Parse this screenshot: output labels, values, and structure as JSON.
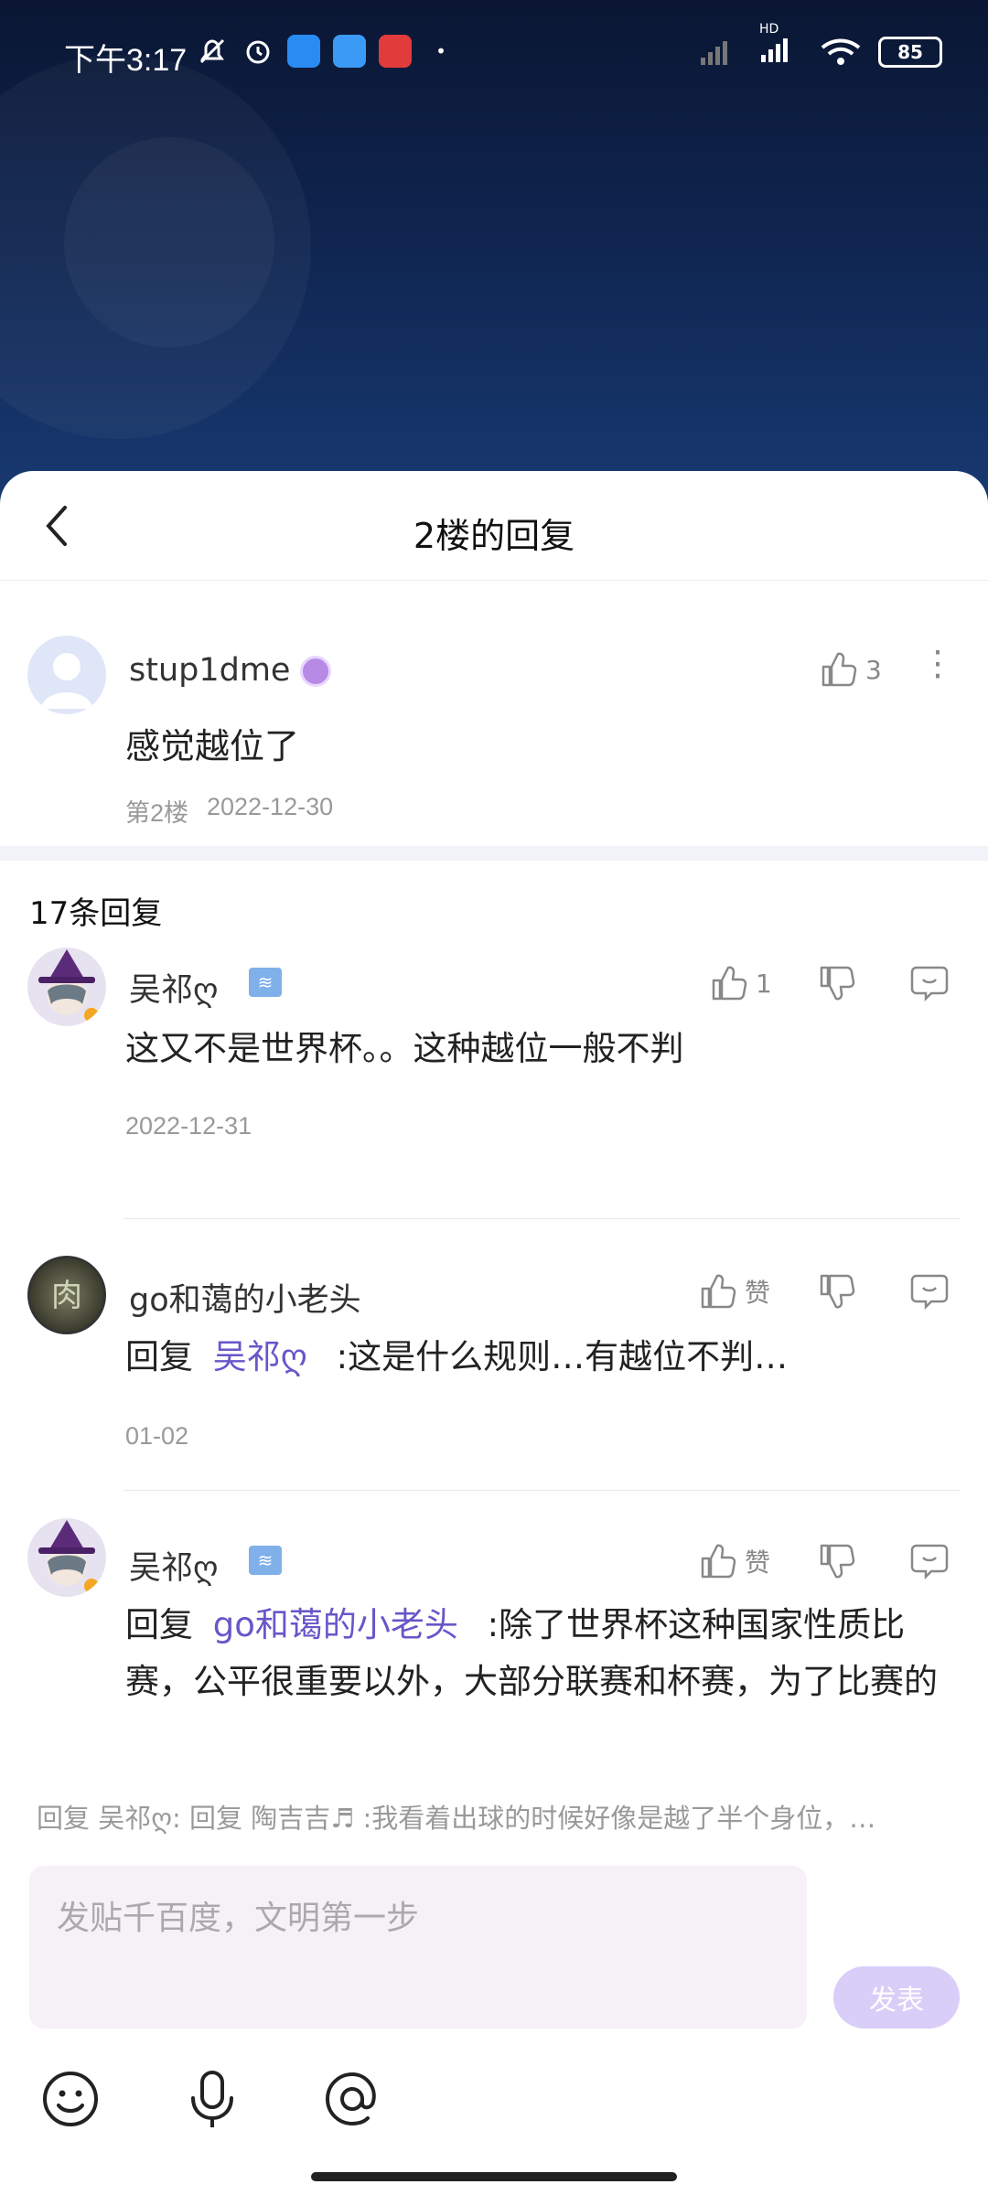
{
  "status_bar": {
    "time": "下午3:17",
    "battery": "85",
    "network_label": "HD"
  },
  "sheet": {
    "title": "2楼的回复"
  },
  "main_post": {
    "username": "stup1dme",
    "likes": "3",
    "text": "感觉越位了",
    "floor": "第2楼",
    "date": "2022-12-30"
  },
  "reply_count": "17条回复",
  "replies": [
    {
      "username": "吴祁ღ",
      "likes": "1",
      "reply_prefix": "",
      "mention": "",
      "text": "这又不是世界杯。。这种越位一般不判",
      "date": "2022-12-31"
    },
    {
      "username": "go和蔼的小老头",
      "likes": "赞",
      "reply_prefix": "回复",
      "mention": "吴祁ღ",
      "text": ":这是什么规则…有越位不判…",
      "date": "01-02"
    },
    {
      "username": "吴祁ღ",
      "likes": "赞",
      "reply_prefix": "回复",
      "mention": "go和蔼的小老头",
      "text": ":除了世界杯这种国家性质比赛，公平很重要以外，大部分联赛和杯赛，为了比赛的",
      "date": ""
    }
  ],
  "composer": {
    "reply_hint": "回复 吴祁ღ: 回复 陶吉吉♬ :我看着出球的时候好像是越了半个身位，…",
    "placeholder": "发贴千百度，文明第一步",
    "send_label": "发表"
  },
  "colors": {
    "accent": "#6a55c9",
    "send_button": "#d9cef8",
    "input_bg": "#f6f1f7"
  }
}
